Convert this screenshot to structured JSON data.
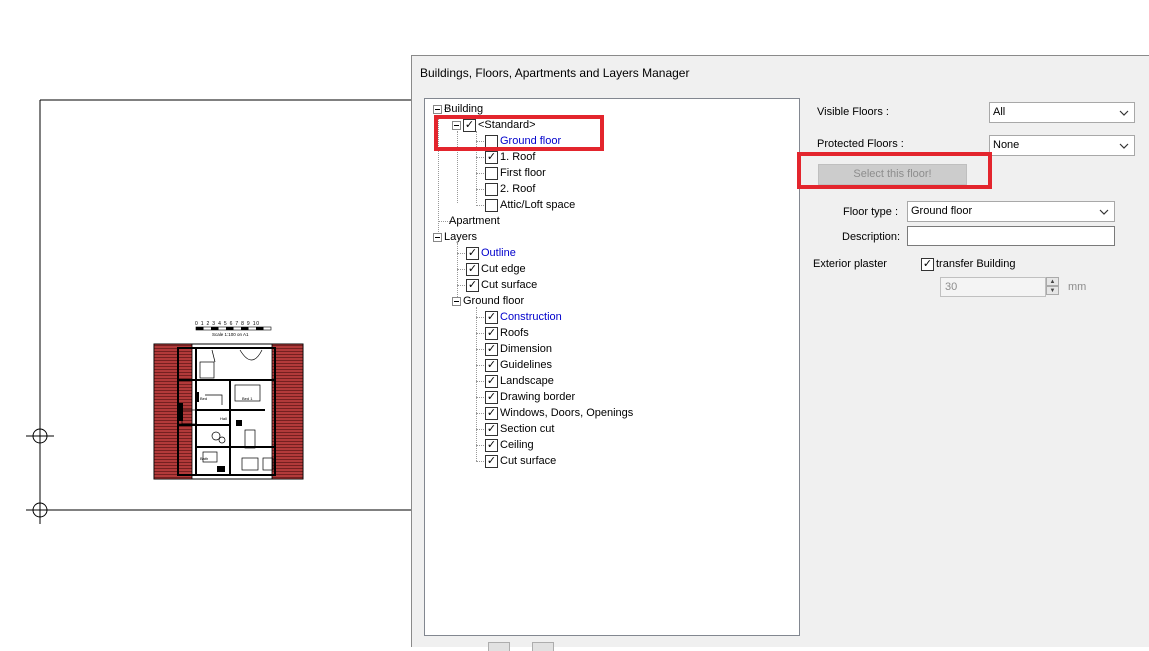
{
  "dialog": {
    "title": "Buildings, Floors, Apartments and Layers Manager"
  },
  "tree": {
    "building": "Building",
    "standard": "<Standard>",
    "floors": [
      {
        "label": "Ground floor",
        "checked": false,
        "highlighted": true
      },
      {
        "label": "1. Roof",
        "checked": true,
        "highlighted": false
      },
      {
        "label": "First floor",
        "checked": false,
        "highlighted": false
      },
      {
        "label": "2. Roof",
        "checked": false,
        "highlighted": false
      },
      {
        "label": "Attic/Loft space",
        "checked": false,
        "highlighted": false
      }
    ],
    "apartment": "Apartment",
    "layers": "Layers",
    "layer_items": [
      {
        "label": "Outline",
        "checked": true,
        "highlighted": true
      },
      {
        "label": "Cut edge",
        "checked": true,
        "highlighted": false
      },
      {
        "label": "Cut surface",
        "checked": true,
        "highlighted": false
      }
    ],
    "ground_floor_group": "Ground floor",
    "ground_floor_items": [
      {
        "label": "Construction",
        "checked": true,
        "highlighted": true
      },
      {
        "label": "Roofs",
        "checked": true,
        "highlighted": false
      },
      {
        "label": "Dimension",
        "checked": true,
        "highlighted": false
      },
      {
        "label": "Guidelines",
        "checked": true,
        "highlighted": false
      },
      {
        "label": "Landscape",
        "checked": true,
        "highlighted": false
      },
      {
        "label": "Drawing border",
        "checked": true,
        "highlighted": false
      },
      {
        "label": "Windows, Doors, Openings",
        "checked": true,
        "highlighted": false
      },
      {
        "label": "Section cut",
        "checked": true,
        "highlighted": false
      },
      {
        "label": "Ceiling",
        "checked": true,
        "highlighted": false
      },
      {
        "label": "Cut surface",
        "checked": true,
        "highlighted": false
      }
    ]
  },
  "properties": {
    "visible_floors_label": "Visible Floors :",
    "visible_floors_value": "All",
    "protected_floors_label": "Protected Floors :",
    "protected_floors_value": "None",
    "select_floor_button": "Select this floor!",
    "floor_type_label": "Floor type :",
    "floor_type_value": "Ground floor",
    "description_label": "Description:",
    "description_value": "",
    "exterior_plaster_label": "Exterior plaster",
    "transfer_building_label": "transfer Building",
    "transfer_building_checked": true,
    "plaster_thickness": "30",
    "plaster_unit": "mm"
  },
  "drawing": {
    "scale_text": "Scale 1:100 on A1",
    "scale_ticks": "0 1 2 3 4 5 6 7 8 9 10",
    "room_labels": [
      "Bed",
      "Bed 1",
      "Hall",
      "Bath"
    ]
  },
  "colors": {
    "highlight_box": "#e3252d",
    "link_blue": "#0000cc",
    "roof_hatch": "#b23a3a"
  }
}
